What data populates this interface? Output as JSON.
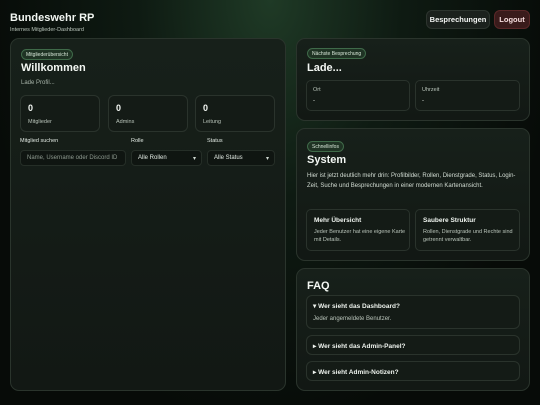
{
  "header": {
    "title": "Bundeswehr RP",
    "subtitle": "Internes Mitglieder-Dashboard",
    "meetings_label": "Besprechungen",
    "logout_label": "Logout"
  },
  "overview": {
    "badge": "Mitgliederübersicht",
    "title": "Willkommen",
    "subtitle": "Lade Profil...",
    "stats": [
      {
        "value": "0",
        "label": "Mitglieder"
      },
      {
        "value": "0",
        "label": "Admins"
      },
      {
        "value": "0",
        "label": "Leitung"
      }
    ],
    "filters": {
      "search_label": "Mitglied suchen",
      "search_placeholder": "Name, Username oder Discord ID",
      "role_label": "Rolle",
      "role_value": "Alle Rollen",
      "status_label": "Status",
      "status_value": "Alle Status"
    }
  },
  "next_meeting": {
    "badge": "Nächste Besprechung",
    "title": "Lade...",
    "location_label": "Ort",
    "location_value": "-",
    "time_label": "Uhrzeit",
    "time_value": "-"
  },
  "info": {
    "badge": "Schnellinfos",
    "title": "System",
    "text": "Hier ist jetzt deutlich mehr drin: Profilbilder, Rollen, Dienstgrade, Status, Login-Zeit, Suche und Besprechungen in einer modernen Kartenansicht.",
    "features": [
      {
        "title": "Mehr Übersicht",
        "desc": "Jeder Benutzer hat eine eigene Karte mit Details."
      },
      {
        "title": "Saubere Struktur",
        "desc": "Rollen, Dienstgrade und Rechte sind getrennt verwaltbar."
      }
    ]
  },
  "faq": {
    "title": "FAQ",
    "items": [
      {
        "question": "Wer sieht das Dashboard?",
        "answer": "Jeder angemeldete Benutzer.",
        "open": true
      },
      {
        "question": "Wer sieht das Admin-Panel?",
        "open": false
      },
      {
        "question": "Wer sieht Admin-Notizen?",
        "open": false
      }
    ]
  }
}
